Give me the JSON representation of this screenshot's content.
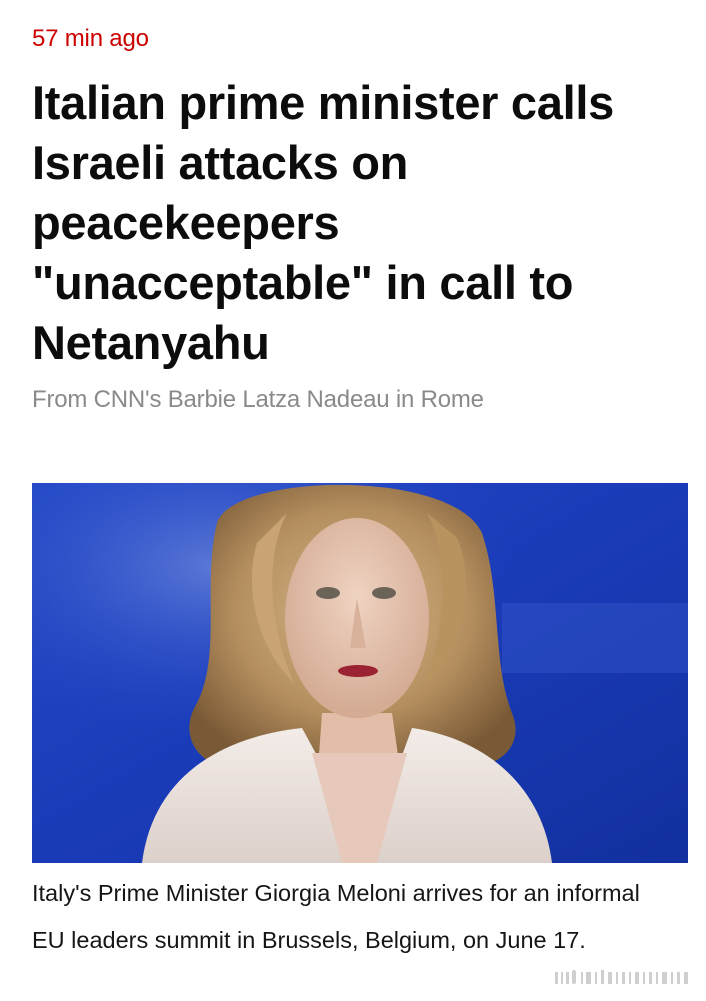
{
  "colors": {
    "timestamp": "#cc0000",
    "headline": "#0c0c0c",
    "byline": "#8a8a8a",
    "caption": "#161616",
    "photo_background": "#1a3fc0"
  },
  "article": {
    "timestamp": "57 min ago",
    "headline_lines": [
      "Italian prime minister calls",
      "Israeli attacks on",
      "peacekeepers",
      "\"unacceptable\" in call to",
      "Netanyahu"
    ],
    "byline": "From CNN's Barbie Latza Nadeau in Rome",
    "photo_icon": "portrait-photo",
    "caption_lines": [
      "Italy's Prime Minister Giorgia Meloni arrives for an informal",
      "EU leaders summit in Brussels, Belgium, on June 17."
    ]
  }
}
